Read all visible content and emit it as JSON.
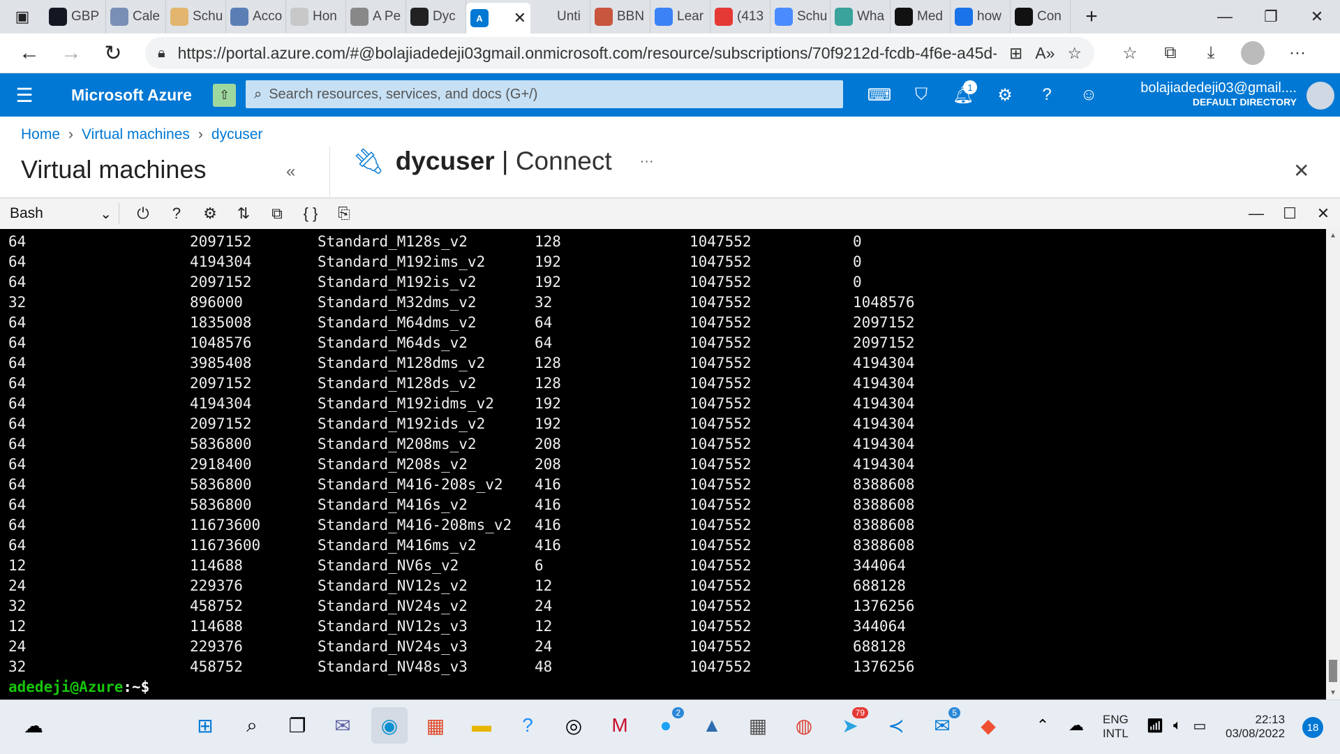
{
  "browser": {
    "tabs": [
      {
        "label": "GBP",
        "icon": "tradingview-icon",
        "color": "#131722"
      },
      {
        "label": "Cale",
        "icon": "calendar-icon",
        "color": "#7a8fb5"
      },
      {
        "label": "Schu",
        "icon": "schedule-icon",
        "color": "#e2b66e"
      },
      {
        "label": "Acco",
        "icon": "account-icon",
        "color": "#5b7fb5"
      },
      {
        "label": "Hon",
        "icon": "page-icon",
        "color": "#c8c8c8"
      },
      {
        "label": "A Pe",
        "icon": "openai-icon",
        "color": "#888"
      },
      {
        "label": "Dyc",
        "icon": "github-icon",
        "color": "#222"
      },
      {
        "label": "",
        "icon": "azure-icon",
        "color": "#0078d4",
        "active": true
      },
      {
        "label": "Unti",
        "icon": "blank-icon",
        "color": "#dfe3e8"
      },
      {
        "label": "BBN",
        "icon": "pinterest-icon",
        "color": "#c8553d"
      },
      {
        "label": "Lear",
        "icon": "bing-icon",
        "color": "#3b82f6"
      },
      {
        "label": "(413",
        "icon": "youtube-icon",
        "color": "#e53935"
      },
      {
        "label": "Schu",
        "icon": "zoom-icon",
        "color": "#4a8cff"
      },
      {
        "label": "Wha",
        "icon": "eye-icon",
        "color": "#3aa39b"
      },
      {
        "label": "Med",
        "icon": "medium-icon",
        "color": "#111"
      },
      {
        "label": "how",
        "icon": "search-icon",
        "color": "#1a73e8"
      },
      {
        "label": "Con",
        "icon": "medium-icon",
        "color": "#111"
      }
    ],
    "active_tab_close": "✕",
    "new_tab": "+",
    "url": "https://portal.azure.com/#@bolajiadedeji03gmail.onmicrosoft.com/resource/subscriptions/70f9212d-fcdb-4f6e-a45d-..."
  },
  "azure": {
    "brand": "Microsoft Azure",
    "search_placeholder": "Search resources, services, and docs (G+/)",
    "notifications_count": "1",
    "user_email": "bolajiadedeji03@gmail....",
    "directory": "DEFAULT DIRECTORY",
    "breadcrumb": [
      "Home",
      "Virtual machines",
      "dycuser"
    ],
    "left_title": "Virtual machines",
    "resource_name": "dycuser",
    "blade_name": "Connect",
    "more": "···"
  },
  "shell": {
    "type": "Bash",
    "rows": [
      [
        "64",
        "2097152",
        "Standard_M128s_v2",
        "128",
        "1047552",
        "0"
      ],
      [
        "64",
        "4194304",
        "Standard_M192ims_v2",
        "192",
        "1047552",
        "0"
      ],
      [
        "64",
        "2097152",
        "Standard_M192is_v2",
        "192",
        "1047552",
        "0"
      ],
      [
        "32",
        "896000",
        "Standard_M32dms_v2",
        "32",
        "1047552",
        "1048576"
      ],
      [
        "64",
        "1835008",
        "Standard_M64dms_v2",
        "64",
        "1047552",
        "2097152"
      ],
      [
        "64",
        "1048576",
        "Standard_M64ds_v2",
        "64",
        "1047552",
        "2097152"
      ],
      [
        "64",
        "3985408",
        "Standard_M128dms_v2",
        "128",
        "1047552",
        "4194304"
      ],
      [
        "64",
        "2097152",
        "Standard_M128ds_v2",
        "128",
        "1047552",
        "4194304"
      ],
      [
        "64",
        "4194304",
        "Standard_M192idms_v2",
        "192",
        "1047552",
        "4194304"
      ],
      [
        "64",
        "2097152",
        "Standard_M192ids_v2",
        "192",
        "1047552",
        "4194304"
      ],
      [
        "64",
        "5836800",
        "Standard_M208ms_v2",
        "208",
        "1047552",
        "4194304"
      ],
      [
        "64",
        "2918400",
        "Standard_M208s_v2",
        "208",
        "1047552",
        "4194304"
      ],
      [
        "64",
        "5836800",
        "Standard_M416-208s_v2",
        "416",
        "1047552",
        "8388608"
      ],
      [
        "64",
        "5836800",
        "Standard_M416s_v2",
        "416",
        "1047552",
        "8388608"
      ],
      [
        "64",
        "11673600",
        "Standard_M416-208ms_v2",
        "416",
        "1047552",
        "8388608"
      ],
      [
        "64",
        "11673600",
        "Standard_M416ms_v2",
        "416",
        "1047552",
        "8388608"
      ],
      [
        "12",
        "114688",
        "Standard_NV6s_v2",
        "6",
        "1047552",
        "344064"
      ],
      [
        "24",
        "229376",
        "Standard_NV12s_v2",
        "12",
        "1047552",
        "688128"
      ],
      [
        "32",
        "458752",
        "Standard_NV24s_v2",
        "24",
        "1047552",
        "1376256"
      ],
      [
        "12",
        "114688",
        "Standard_NV12s_v3",
        "12",
        "1047552",
        "344064"
      ],
      [
        "24",
        "229376",
        "Standard_NV24s_v3",
        "24",
        "1047552",
        "688128"
      ],
      [
        "32",
        "458752",
        "Standard_NV48s_v3",
        "48",
        "1047552",
        "1376256"
      ]
    ],
    "prompt_user": "adedeji@Azure",
    "prompt_path": ":~$"
  },
  "taskbar": {
    "twitter_badge": "2",
    "telegram_badge": "79",
    "mail_badge": "5",
    "language": "ENG",
    "layout": "INTL",
    "time": "22:13",
    "date": "03/08/2022",
    "notification_count": "18"
  },
  "colors": {
    "azure_blue": "#0078d4",
    "prompt_green": "#16c60c",
    "terminal_bg": "#000000"
  }
}
